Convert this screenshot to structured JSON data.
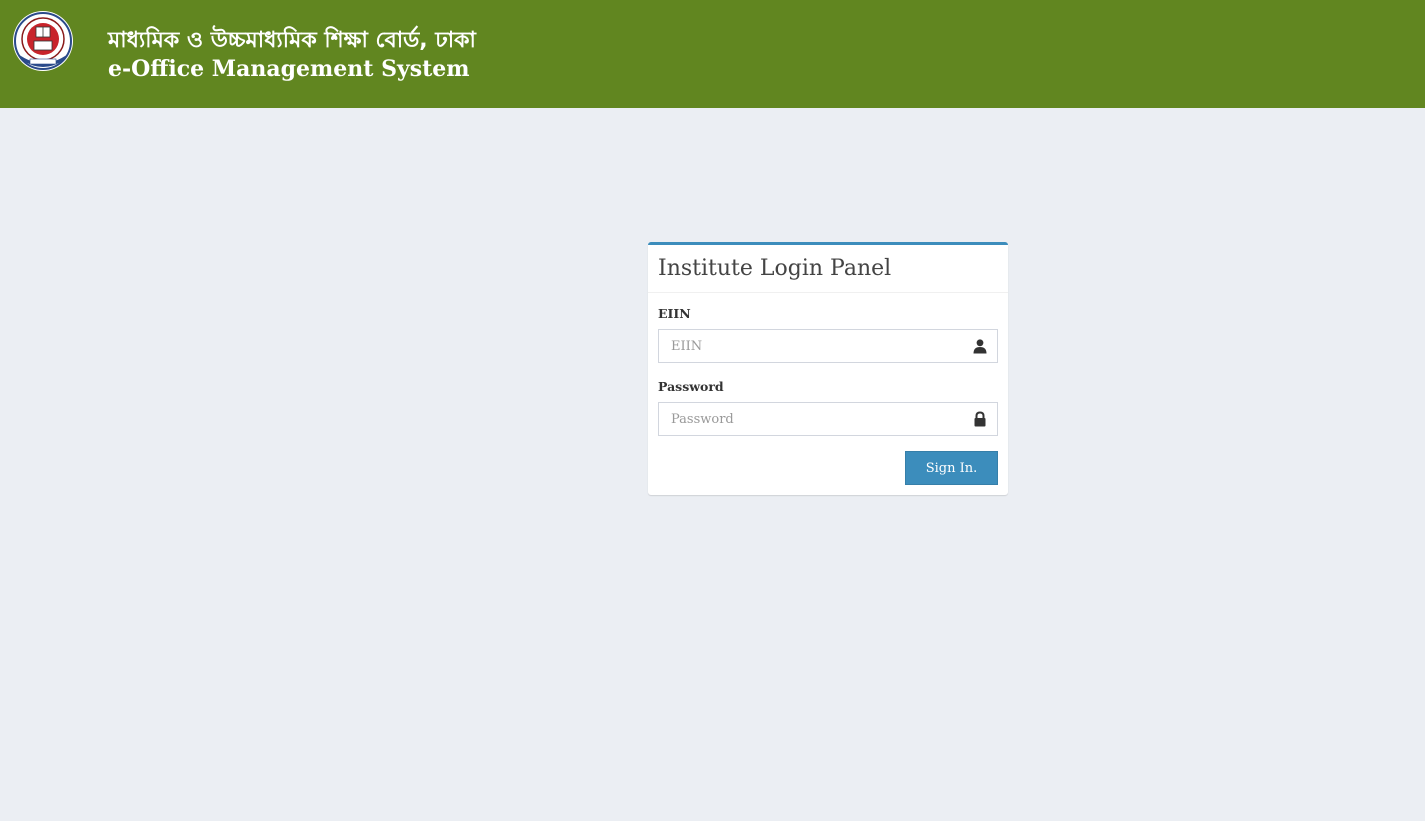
{
  "header": {
    "title_bn": "মাধ্যমিক ও উচ্চমাধ্যমিক শিক্ষা বোর্ড, ঢাকা",
    "title_en": "e-Office Management System",
    "logo_icon": "board-seal-logo",
    "background_color": "#618620"
  },
  "login_panel": {
    "title": "Institute Login Panel",
    "accent_color": "#3c8dbc",
    "eiin": {
      "label": "EIIN",
      "placeholder": "EIIN",
      "value": "",
      "icon": "user-icon"
    },
    "password": {
      "label": "Password",
      "placeholder": "Password",
      "value": "",
      "icon": "lock-icon"
    },
    "submit_label": "Sign In."
  }
}
